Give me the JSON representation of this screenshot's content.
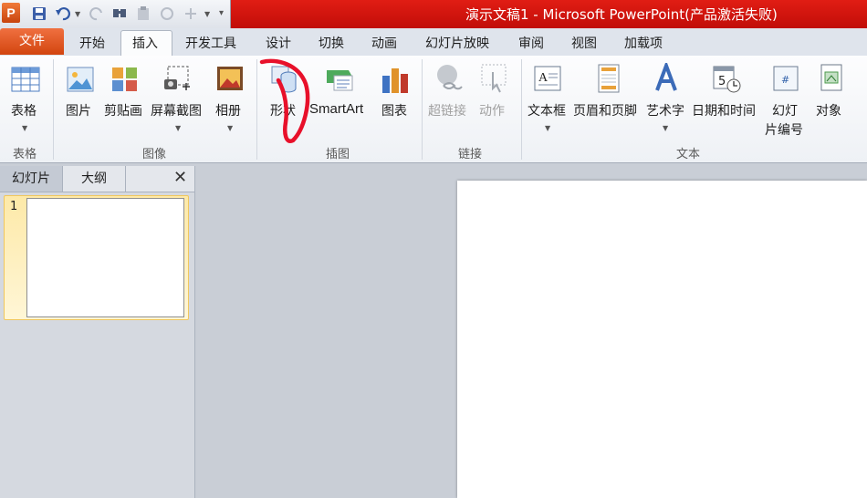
{
  "window": {
    "title": "演示文稿1 - Microsoft PowerPoint(产品激活失败)",
    "app_logo": "P"
  },
  "qat": {
    "icons": [
      "save-icon",
      "undo-icon",
      "redo-icon",
      "find-icon",
      "paste-icon",
      "circle-icon",
      "shape-icon",
      "customize-icon"
    ]
  },
  "tabs": {
    "file": "文件",
    "items": [
      "开始",
      "插入",
      "开发工具",
      "设计",
      "切换",
      "动画",
      "幻灯片放映",
      "审阅",
      "视图",
      "加载项"
    ],
    "active": "插入"
  },
  "ribbon": {
    "groups": {
      "table": {
        "label": "表格",
        "buttons": [
          "表格"
        ]
      },
      "images": {
        "label": "图像",
        "buttons": [
          "图片",
          "剪贴画",
          "屏幕截图",
          "相册"
        ]
      },
      "illustrations": {
        "label": "插图",
        "buttons": [
          "形状",
          "SmartArt",
          "图表"
        ]
      },
      "links": {
        "label": "链接",
        "buttons": [
          "超链接",
          "动作"
        ]
      },
      "text": {
        "label": "文本",
        "buttons": [
          "文本框",
          "页眉和页脚",
          "艺术字",
          "日期和时间",
          "幻灯",
          "片编号",
          "对象"
        ]
      }
    }
  },
  "slides_pane": {
    "tabs": [
      "幻灯片",
      "大纲"
    ],
    "close": "✕",
    "slides": [
      {
        "number": "1"
      }
    ]
  },
  "colors": {
    "title_bar": "#d0140e",
    "file_tab": "#e05a22",
    "annotation": "#e8102a",
    "selection": "#fde9a8"
  }
}
